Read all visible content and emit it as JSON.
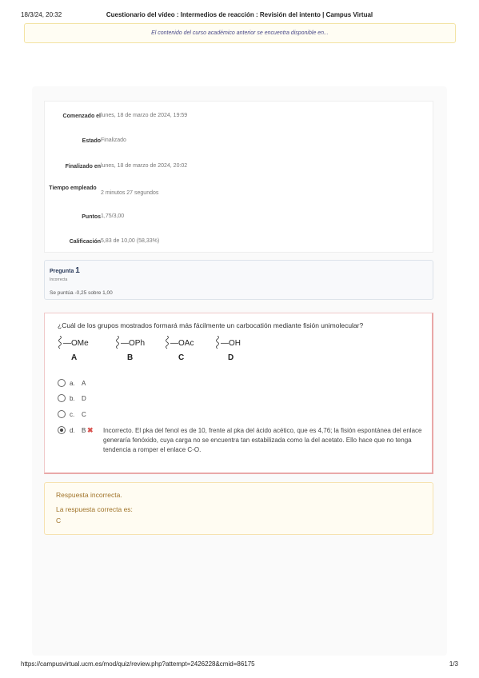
{
  "print_header": {
    "date": "18/3/24, 20:32",
    "title": "Cuestionario del vídeo : Intermedios de reacción : Revisión del intento | Campus Virtual"
  },
  "notice": "El contenido del curso académico anterior se encuentra disponible en...",
  "summary": [
    {
      "label": "Comenzado el",
      "value": "lunes, 18 de marzo de 2024, 19:59"
    },
    {
      "label": "Estado",
      "value": "Finalizado"
    },
    {
      "label": "Finalizado en",
      "value": "lunes, 18 de marzo de 2024, 20:02"
    },
    {
      "label": "Tiempo empleado",
      "value": "2 minutos 27 segundos"
    },
    {
      "label": "Puntos",
      "value": "1,75/3,00"
    },
    {
      "label": "Calificación",
      "value": "5,83 de 10,00 (58,33%)"
    }
  ],
  "question": {
    "label": "Pregunta",
    "number": "1",
    "status": "Incorrecta",
    "score": "Se puntúa -0,25 sobre 1,00",
    "text": "¿Cuál de los grupos mostrados formará más fácilmente un carbocatión mediante fisión unimolecular?",
    "structures": [
      {
        "group": "—OMe",
        "letter": "A"
      },
      {
        "group": "—OPh",
        "letter": "B"
      },
      {
        "group": "—OAc",
        "letter": "C"
      },
      {
        "group": "—OH",
        "letter": "D"
      }
    ],
    "options": [
      {
        "letter": "a.",
        "answer": "A"
      },
      {
        "letter": "b.",
        "answer": "D"
      },
      {
        "letter": "c.",
        "answer": "C"
      },
      {
        "letter": "d.",
        "answer": "B"
      }
    ],
    "feedback": "Incorrecto. El pka del fenol es de 10, frente al pka del ácido acético, que es 4,76; la fisión espontánea del enlace generaría fenóxido, cuya carga no se encuentra tan estabilizada como la del acetato. Ello hace que no tenga tendencia a romper el enlace C-O."
  },
  "answer": {
    "incorrect": "Respuesta incorrecta.",
    "correct_label": "La respuesta correcta es:",
    "correct_value": "C"
  },
  "print_footer": {
    "url": "https://campusvirtual.ucm.es/mod/quiz/review.php?attempt=2426228&cmid=86175",
    "page": "1/3"
  }
}
